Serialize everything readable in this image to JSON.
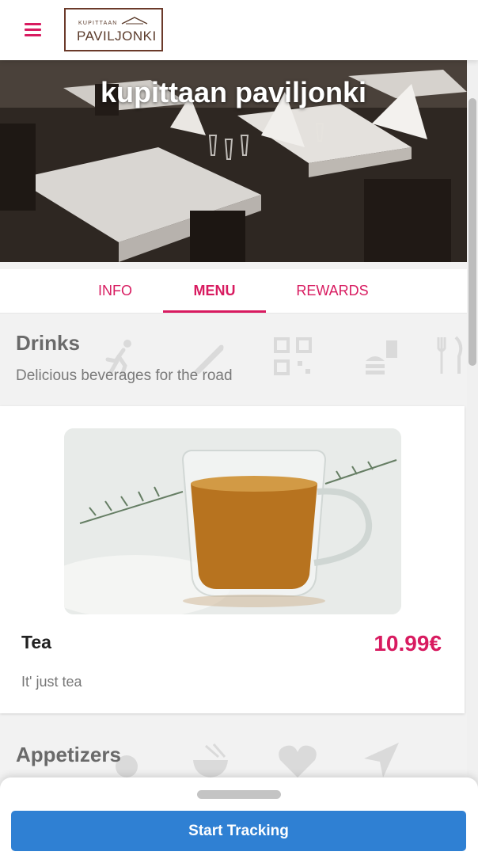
{
  "header": {
    "menu_icon": "hamburger-menu-icon",
    "logo_top": "KUPITTAAN",
    "logo_bottom": "PAVILJONKI"
  },
  "hero": {
    "title": "kupittaan paviljonki",
    "image": "restaurant-dining-room-photo"
  },
  "tabs": [
    {
      "label": "INFO",
      "active": false
    },
    {
      "label": "MENU",
      "active": true
    },
    {
      "label": "REWARDS",
      "active": false
    }
  ],
  "categories": [
    {
      "title": "Drinks",
      "description": "Delicious beverages for the road",
      "items": [
        {
          "name": "Tea",
          "price": "10.99€",
          "description": "It' just tea",
          "image": "tea-cup-photo"
        }
      ]
    },
    {
      "title": "Appetizers"
    }
  ],
  "bottom_sheet": {
    "button_label": "Start Tracking"
  },
  "colors": {
    "accent": "#d81b60",
    "button": "#2f80d3"
  }
}
